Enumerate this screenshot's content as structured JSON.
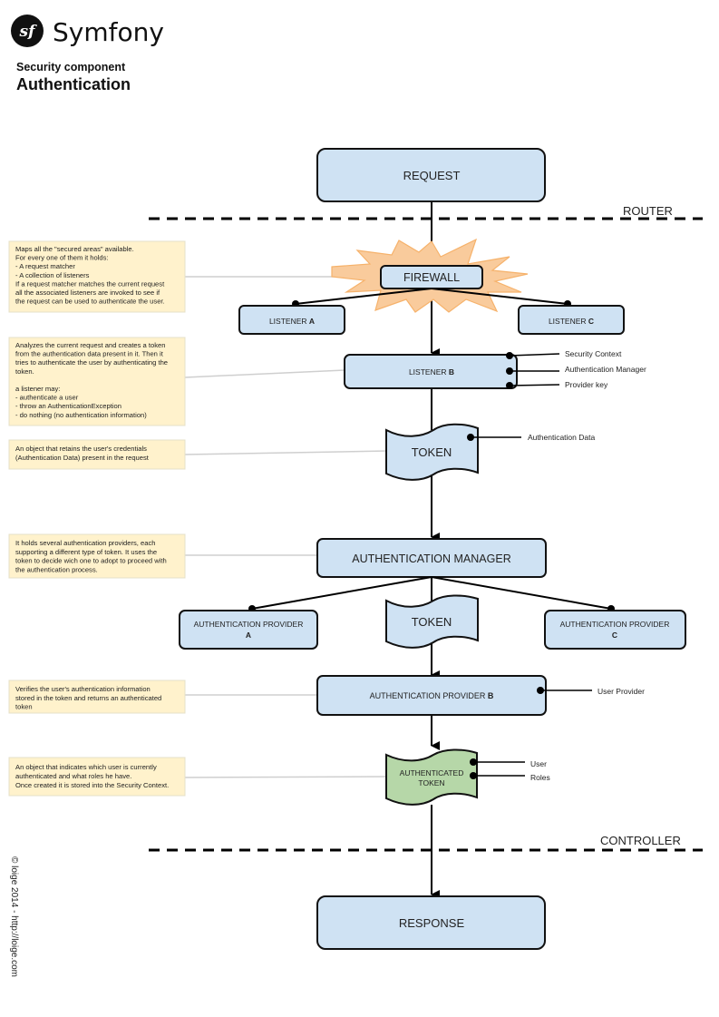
{
  "header": {
    "brand": "Symfony",
    "logo_glyph": "sf",
    "subtitle": "Security component",
    "title": "Authentication"
  },
  "colors": {
    "box_fill": "#cfe2f3",
    "token_green": "#b6d7a8",
    "note_fill": "#fff2cc",
    "burst_fill": "#f9cb9c",
    "burst_stroke": "#f6b26b",
    "connector_gray": "#cccccc"
  },
  "zones": {
    "router": "ROUTER",
    "controller": "CONTROLLER"
  },
  "nodes": {
    "request": "REQUEST",
    "firewall": "FIREWALL",
    "listener_a": {
      "prefix": "LISTENER ",
      "suffix": "A"
    },
    "listener_b": {
      "prefix": "LISTENER ",
      "suffix": "B"
    },
    "listener_c": {
      "prefix": "LISTENER ",
      "suffix": "C"
    },
    "token1": "TOKEN",
    "auth_manager": "AUTHENTICATION MANAGER",
    "provider_a": {
      "line1": "AUTHENTICATION PROVIDER",
      "line2": "A"
    },
    "provider_b": {
      "prefix": "AUTHENTICATION PROVIDER ",
      "suffix": "B"
    },
    "provider_c": {
      "line1": "AUTHENTICATION PROVIDER",
      "line2": "C"
    },
    "token2": "TOKEN",
    "auth_token": {
      "line1": "AUTHENTICATED",
      "line2": "TOKEN"
    },
    "response": "RESPONSE"
  },
  "side_labels": {
    "security_context": "Security Context",
    "authentication_manager": "Authentication Manager",
    "provider_key": "Provider key",
    "authentication_data": "Authentication Data",
    "user_provider": "User Provider",
    "user": "User",
    "roles": "Roles"
  },
  "notes": {
    "firewall": [
      "Maps all the \"secured areas\" available.",
      "For every one of them it holds:",
      "- A request matcher",
      "- A collection of listeners",
      "If a request matcher matches the current request",
      "all the associated listeners are invoked to see if",
      "the request can be used to authenticate the user."
    ],
    "listener": [
      "Analyzes the current request and creates a token",
      "from the authentication data present in it. Then it",
      "tries to authenticate the user by authenticating the",
      "token.",
      "",
      "a listener may:",
      "- authenticate a user",
      "- throw an AuthenticationException",
      "- do nothing (no authentication information)"
    ],
    "token": [
      "An object that retains the user's credentials",
      "(Authentication Data) present in the request"
    ],
    "manager": [
      "It holds several authentication providers, each",
      "supporting a different type of token. It uses the",
      "token to decide wich one to adopt to proceed with",
      "the authentication process."
    ],
    "provider": [
      "Verifies the user's authentication information",
      "stored in the token and returns an authenticated",
      "token"
    ],
    "auth_token": [
      "An object that indicates which user is currently",
      "authenticated and what roles he have.",
      "Once created it is stored into the Security Context."
    ]
  },
  "footer": {
    "copyright": "© loige 2014 - http://loige.com"
  }
}
